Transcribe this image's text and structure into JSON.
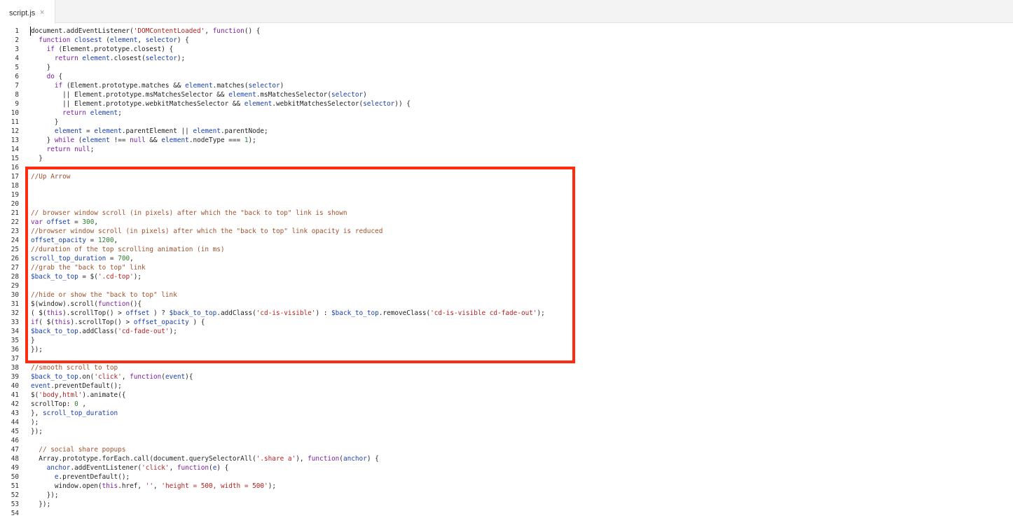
{
  "tabs": [
    {
      "label": "script.js",
      "close_symbol": "×"
    }
  ],
  "highlight": {
    "color": "#ff2a10"
  },
  "lines": [
    [
      [
        "p",
        "document.addEventListener("
      ],
      [
        "s",
        "'DOMContentLoaded'"
      ],
      [
        "p",
        ", "
      ],
      [
        "k",
        "function"
      ],
      [
        "p",
        "() {"
      ]
    ],
    [
      [
        "p",
        "  "
      ],
      [
        "k",
        "function"
      ],
      [
        "p",
        " "
      ],
      [
        "v",
        "closest"
      ],
      [
        "p",
        " ("
      ],
      [
        "v",
        "element"
      ],
      [
        "p",
        ", "
      ],
      [
        "v",
        "selector"
      ],
      [
        "p",
        ") {"
      ]
    ],
    [
      [
        "p",
        "    "
      ],
      [
        "k",
        "if"
      ],
      [
        "p",
        " (Element.prototype.closest) {"
      ]
    ],
    [
      [
        "p",
        "      "
      ],
      [
        "k",
        "return"
      ],
      [
        "p",
        " "
      ],
      [
        "v",
        "element"
      ],
      [
        "p",
        ".closest("
      ],
      [
        "v",
        "selector"
      ],
      [
        "p",
        ");"
      ]
    ],
    [
      [
        "p",
        "    }"
      ]
    ],
    [
      [
        "p",
        "    "
      ],
      [
        "k",
        "do"
      ],
      [
        "p",
        " {"
      ]
    ],
    [
      [
        "p",
        "      "
      ],
      [
        "k",
        "if"
      ],
      [
        "p",
        " (Element.prototype.matches && "
      ],
      [
        "v",
        "element"
      ],
      [
        "p",
        ".matches("
      ],
      [
        "v",
        "selector"
      ],
      [
        "p",
        ")"
      ]
    ],
    [
      [
        "p",
        "        || Element.prototype.msMatchesSelector && "
      ],
      [
        "v",
        "element"
      ],
      [
        "p",
        ".msMatchesSelector("
      ],
      [
        "v",
        "selector"
      ],
      [
        "p",
        ")"
      ]
    ],
    [
      [
        "p",
        "        || Element.prototype.webkitMatchesSelector && "
      ],
      [
        "v",
        "element"
      ],
      [
        "p",
        ".webkitMatchesSelector("
      ],
      [
        "v",
        "selector"
      ],
      [
        "p",
        ")) {"
      ]
    ],
    [
      [
        "p",
        "        "
      ],
      [
        "k",
        "return"
      ],
      [
        "p",
        " "
      ],
      [
        "v",
        "element"
      ],
      [
        "p",
        ";"
      ]
    ],
    [
      [
        "p",
        "      }"
      ]
    ],
    [
      [
        "p",
        "      "
      ],
      [
        "v",
        "element"
      ],
      [
        "p",
        " = "
      ],
      [
        "v",
        "element"
      ],
      [
        "p",
        ".parentElement || "
      ],
      [
        "v",
        "element"
      ],
      [
        "p",
        ".parentNode;"
      ]
    ],
    [
      [
        "p",
        "    } "
      ],
      [
        "k",
        "while"
      ],
      [
        "p",
        " ("
      ],
      [
        "v",
        "element"
      ],
      [
        "p",
        " !== "
      ],
      [
        "k",
        "null"
      ],
      [
        "p",
        " && "
      ],
      [
        "v",
        "element"
      ],
      [
        "p",
        ".nodeType === "
      ],
      [
        "n",
        "1"
      ],
      [
        "p",
        ");"
      ]
    ],
    [
      [
        "p",
        "    "
      ],
      [
        "k",
        "return"
      ],
      [
        "p",
        " "
      ],
      [
        "k",
        "null"
      ],
      [
        "p",
        ";"
      ]
    ],
    [
      [
        "p",
        "  }"
      ]
    ],
    [],
    [
      [
        "c",
        "//Up Arrow"
      ]
    ],
    [],
    [],
    [],
    [
      [
        "c",
        "// browser window scroll (in pixels) after which the \"back to top\" link is shown"
      ]
    ],
    [
      [
        "k",
        "var"
      ],
      [
        "p",
        " "
      ],
      [
        "v",
        "offset"
      ],
      [
        "p",
        " = "
      ],
      [
        "n",
        "300"
      ],
      [
        "p",
        ","
      ]
    ],
    [
      [
        "c",
        "//browser window scroll (in pixels) after which the \"back to top\" link opacity is reduced"
      ]
    ],
    [
      [
        "v",
        "offset_opacity"
      ],
      [
        "p",
        " = "
      ],
      [
        "n",
        "1200"
      ],
      [
        "p",
        ","
      ]
    ],
    [
      [
        "c",
        "//duration of the top scrolling animation (in ms)"
      ]
    ],
    [
      [
        "v",
        "scroll_top_duration"
      ],
      [
        "p",
        " = "
      ],
      [
        "n",
        "700"
      ],
      [
        "p",
        ","
      ]
    ],
    [
      [
        "c",
        "//grab the \"back to top\" link"
      ]
    ],
    [
      [
        "v",
        "$back_to_top"
      ],
      [
        "p",
        " = $("
      ],
      [
        "s",
        "'.cd-top'"
      ],
      [
        "p",
        ");"
      ]
    ],
    [],
    [
      [
        "c",
        "//hide or show the \"back to top\" link"
      ]
    ],
    [
      [
        "p",
        "$(window).scroll("
      ],
      [
        "k",
        "function"
      ],
      [
        "p",
        "(){"
      ]
    ],
    [
      [
        "p",
        "( $("
      ],
      [
        "k",
        "this"
      ],
      [
        "p",
        ").scrollTop() > "
      ],
      [
        "v",
        "offset"
      ],
      [
        "p",
        " ) ? "
      ],
      [
        "v",
        "$back_to_top"
      ],
      [
        "p",
        ".addClass("
      ],
      [
        "s",
        "'cd-is-visible'"
      ],
      [
        "p",
        ") : "
      ],
      [
        "v",
        "$back_to_top"
      ],
      [
        "p",
        ".removeClass("
      ],
      [
        "s",
        "'cd-is-visible cd-fade-out'"
      ],
      [
        "p",
        ");"
      ]
    ],
    [
      [
        "k",
        "if"
      ],
      [
        "p",
        "( $("
      ],
      [
        "k",
        "this"
      ],
      [
        "p",
        ").scrollTop() > "
      ],
      [
        "v",
        "offset_opacity"
      ],
      [
        "p",
        " ) {"
      ]
    ],
    [
      [
        "v",
        "$back_to_top"
      ],
      [
        "p",
        ".addClass("
      ],
      [
        "s",
        "'cd-fade-out'"
      ],
      [
        "p",
        ");"
      ]
    ],
    [
      [
        "p",
        "}"
      ]
    ],
    [
      [
        "p",
        "});"
      ]
    ],
    [],
    [
      [
        "c",
        "//smooth scroll to top"
      ]
    ],
    [
      [
        "v",
        "$back_to_top"
      ],
      [
        "p",
        ".on("
      ],
      [
        "s",
        "'click'"
      ],
      [
        "p",
        ", "
      ],
      [
        "k",
        "function"
      ],
      [
        "p",
        "("
      ],
      [
        "v",
        "event"
      ],
      [
        "p",
        "){"
      ]
    ],
    [
      [
        "v",
        "event"
      ],
      [
        "p",
        ".preventDefault();"
      ]
    ],
    [
      [
        "p",
        "$("
      ],
      [
        "s",
        "'body,html'"
      ],
      [
        "p",
        ").animate({"
      ]
    ],
    [
      [
        "p",
        "scrollTop: "
      ],
      [
        "n",
        "0"
      ],
      [
        "p",
        " ,"
      ]
    ],
    [
      [
        "p",
        "}, "
      ],
      [
        "v",
        "scroll_top_duration"
      ]
    ],
    [
      [
        "p",
        ");"
      ]
    ],
    [
      [
        "p",
        "});"
      ]
    ],
    [],
    [
      [
        "p",
        "  "
      ],
      [
        "c",
        "// social share popups"
      ]
    ],
    [
      [
        "p",
        "  Array.prototype.forEach.call(document.querySelectorAll("
      ],
      [
        "s",
        "'.share a'"
      ],
      [
        "p",
        "), "
      ],
      [
        "k",
        "function"
      ],
      [
        "p",
        "("
      ],
      [
        "v",
        "anchor"
      ],
      [
        "p",
        ") {"
      ]
    ],
    [
      [
        "p",
        "    "
      ],
      [
        "v",
        "anchor"
      ],
      [
        "p",
        ".addEventListener("
      ],
      [
        "s",
        "'click'"
      ],
      [
        "p",
        ", "
      ],
      [
        "k",
        "function"
      ],
      [
        "p",
        "("
      ],
      [
        "v",
        "e"
      ],
      [
        "p",
        ") {"
      ]
    ],
    [
      [
        "p",
        "      "
      ],
      [
        "v",
        "e"
      ],
      [
        "p",
        ".preventDefault();"
      ]
    ],
    [
      [
        "p",
        "      window.open("
      ],
      [
        "k",
        "this"
      ],
      [
        "p",
        ".href, "
      ],
      [
        "s",
        "''"
      ],
      [
        "p",
        ", "
      ],
      [
        "s",
        "'height = 500, width = 500'"
      ],
      [
        "p",
        ");"
      ]
    ],
    [
      [
        "p",
        "    });"
      ]
    ],
    [
      [
        "p",
        "  });"
      ]
    ],
    []
  ]
}
